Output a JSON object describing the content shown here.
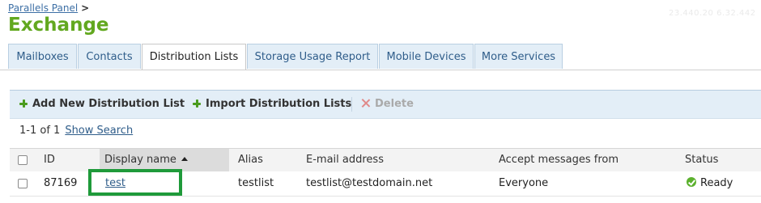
{
  "header": {
    "faint_text": "23.440.20 6.32.442",
    "breadcrumb_link": "Parallels Panel",
    "breadcrumb_separator": ">",
    "title": "Exchange"
  },
  "tabs": [
    {
      "label": "Mailboxes",
      "active": false
    },
    {
      "label": "Contacts",
      "active": false
    },
    {
      "label": "Distribution Lists",
      "active": true
    },
    {
      "label": "Storage Usage Report",
      "active": false
    },
    {
      "label": "Mobile Devices",
      "active": false
    },
    {
      "label": "More Services",
      "active": false
    }
  ],
  "toolbar": {
    "add_label": "Add New Distribution List",
    "import_label": "Import Distribution Lists",
    "delete_label": "Delete"
  },
  "paging": {
    "range": "1-1 of 1",
    "show_search": "Show Search"
  },
  "table": {
    "columns": [
      "ID",
      "Display name",
      "Alias",
      "E-mail address",
      "Accept messages from",
      "Status"
    ],
    "rows": [
      {
        "id": "87169",
        "display_name": "test",
        "alias": "testlist",
        "email": "testlist@testdomain.net",
        "accept_from": "Everyone",
        "status": "Ready"
      }
    ]
  },
  "colors": {
    "title_green": "#62a81f",
    "tab_bg": "#e3eef7",
    "link_blue": "#2f5d8a",
    "highlight_green": "#1f9a3a"
  }
}
